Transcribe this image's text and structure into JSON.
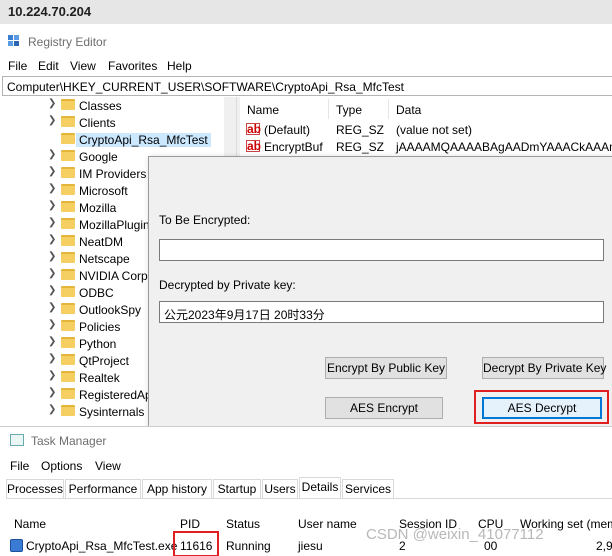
{
  "host": "10.224.70.204",
  "regedit": {
    "title": "Registry Editor",
    "menu": [
      "File",
      "Edit",
      "View",
      "Favorites",
      "Help"
    ],
    "address": "Computer\\HKEY_CURRENT_USER\\SOFTWARE\\CryptoApi_Rsa_MfcTest",
    "tree": [
      "Classes",
      "Clients",
      "CryptoApi_Rsa_MfcTest",
      "Google",
      "IM Providers",
      "Microsoft",
      "Mozilla",
      "MozillaPlugin",
      "NeatDM",
      "Netscape",
      "NVIDIA Corpo",
      "ODBC",
      "OutlookSpy",
      "Policies",
      "Python",
      "QtProject",
      "Realtek",
      "RegisteredAp",
      "Sysinternals"
    ],
    "selected_key": "CryptoApi_Rsa_MfcTest",
    "columns": {
      "name": "Name",
      "type": "Type",
      "data": "Data"
    },
    "values": [
      {
        "name": "(Default)",
        "type": "REG_SZ",
        "data": "(value not set)"
      },
      {
        "name": "EncryptBuf",
        "type": "REG_SZ",
        "data": "jAAAAMQAAAABAgAADmYAAACkAAAm"
      }
    ]
  },
  "dialog": {
    "encrypt_label": "To Be Encrypted:",
    "encrypt_value": "",
    "decrypt_label": "Decrypted by Private key:",
    "decrypt_value": "公元2023年9月17日 20时33分",
    "buttons": {
      "encrypt_public": "Encrypt By Public Key",
      "decrypt_private": "Decrypt By Private Key",
      "aes_encrypt": "AES Encrypt",
      "aes_decrypt": "AES Decrypt"
    }
  },
  "taskmgr": {
    "title": "Task Manager",
    "menu": [
      "File",
      "Options",
      "View"
    ],
    "tabs": [
      "Processes",
      "Performance",
      "App history",
      "Startup",
      "Users",
      "Details",
      "Services"
    ],
    "active_tab": "Details",
    "columns": [
      "Name",
      "PID",
      "Status",
      "User name",
      "Session ID",
      "CPU",
      "Working set (mem"
    ],
    "row": {
      "name": "CryptoApi_Rsa_MfcTest.exe",
      "pid": "11616",
      "status": "Running",
      "user": "jiesu",
      "session": "2",
      "cpu": "00",
      "mem": "2,9"
    }
  },
  "watermark": "CSDN @weixin_41077112"
}
